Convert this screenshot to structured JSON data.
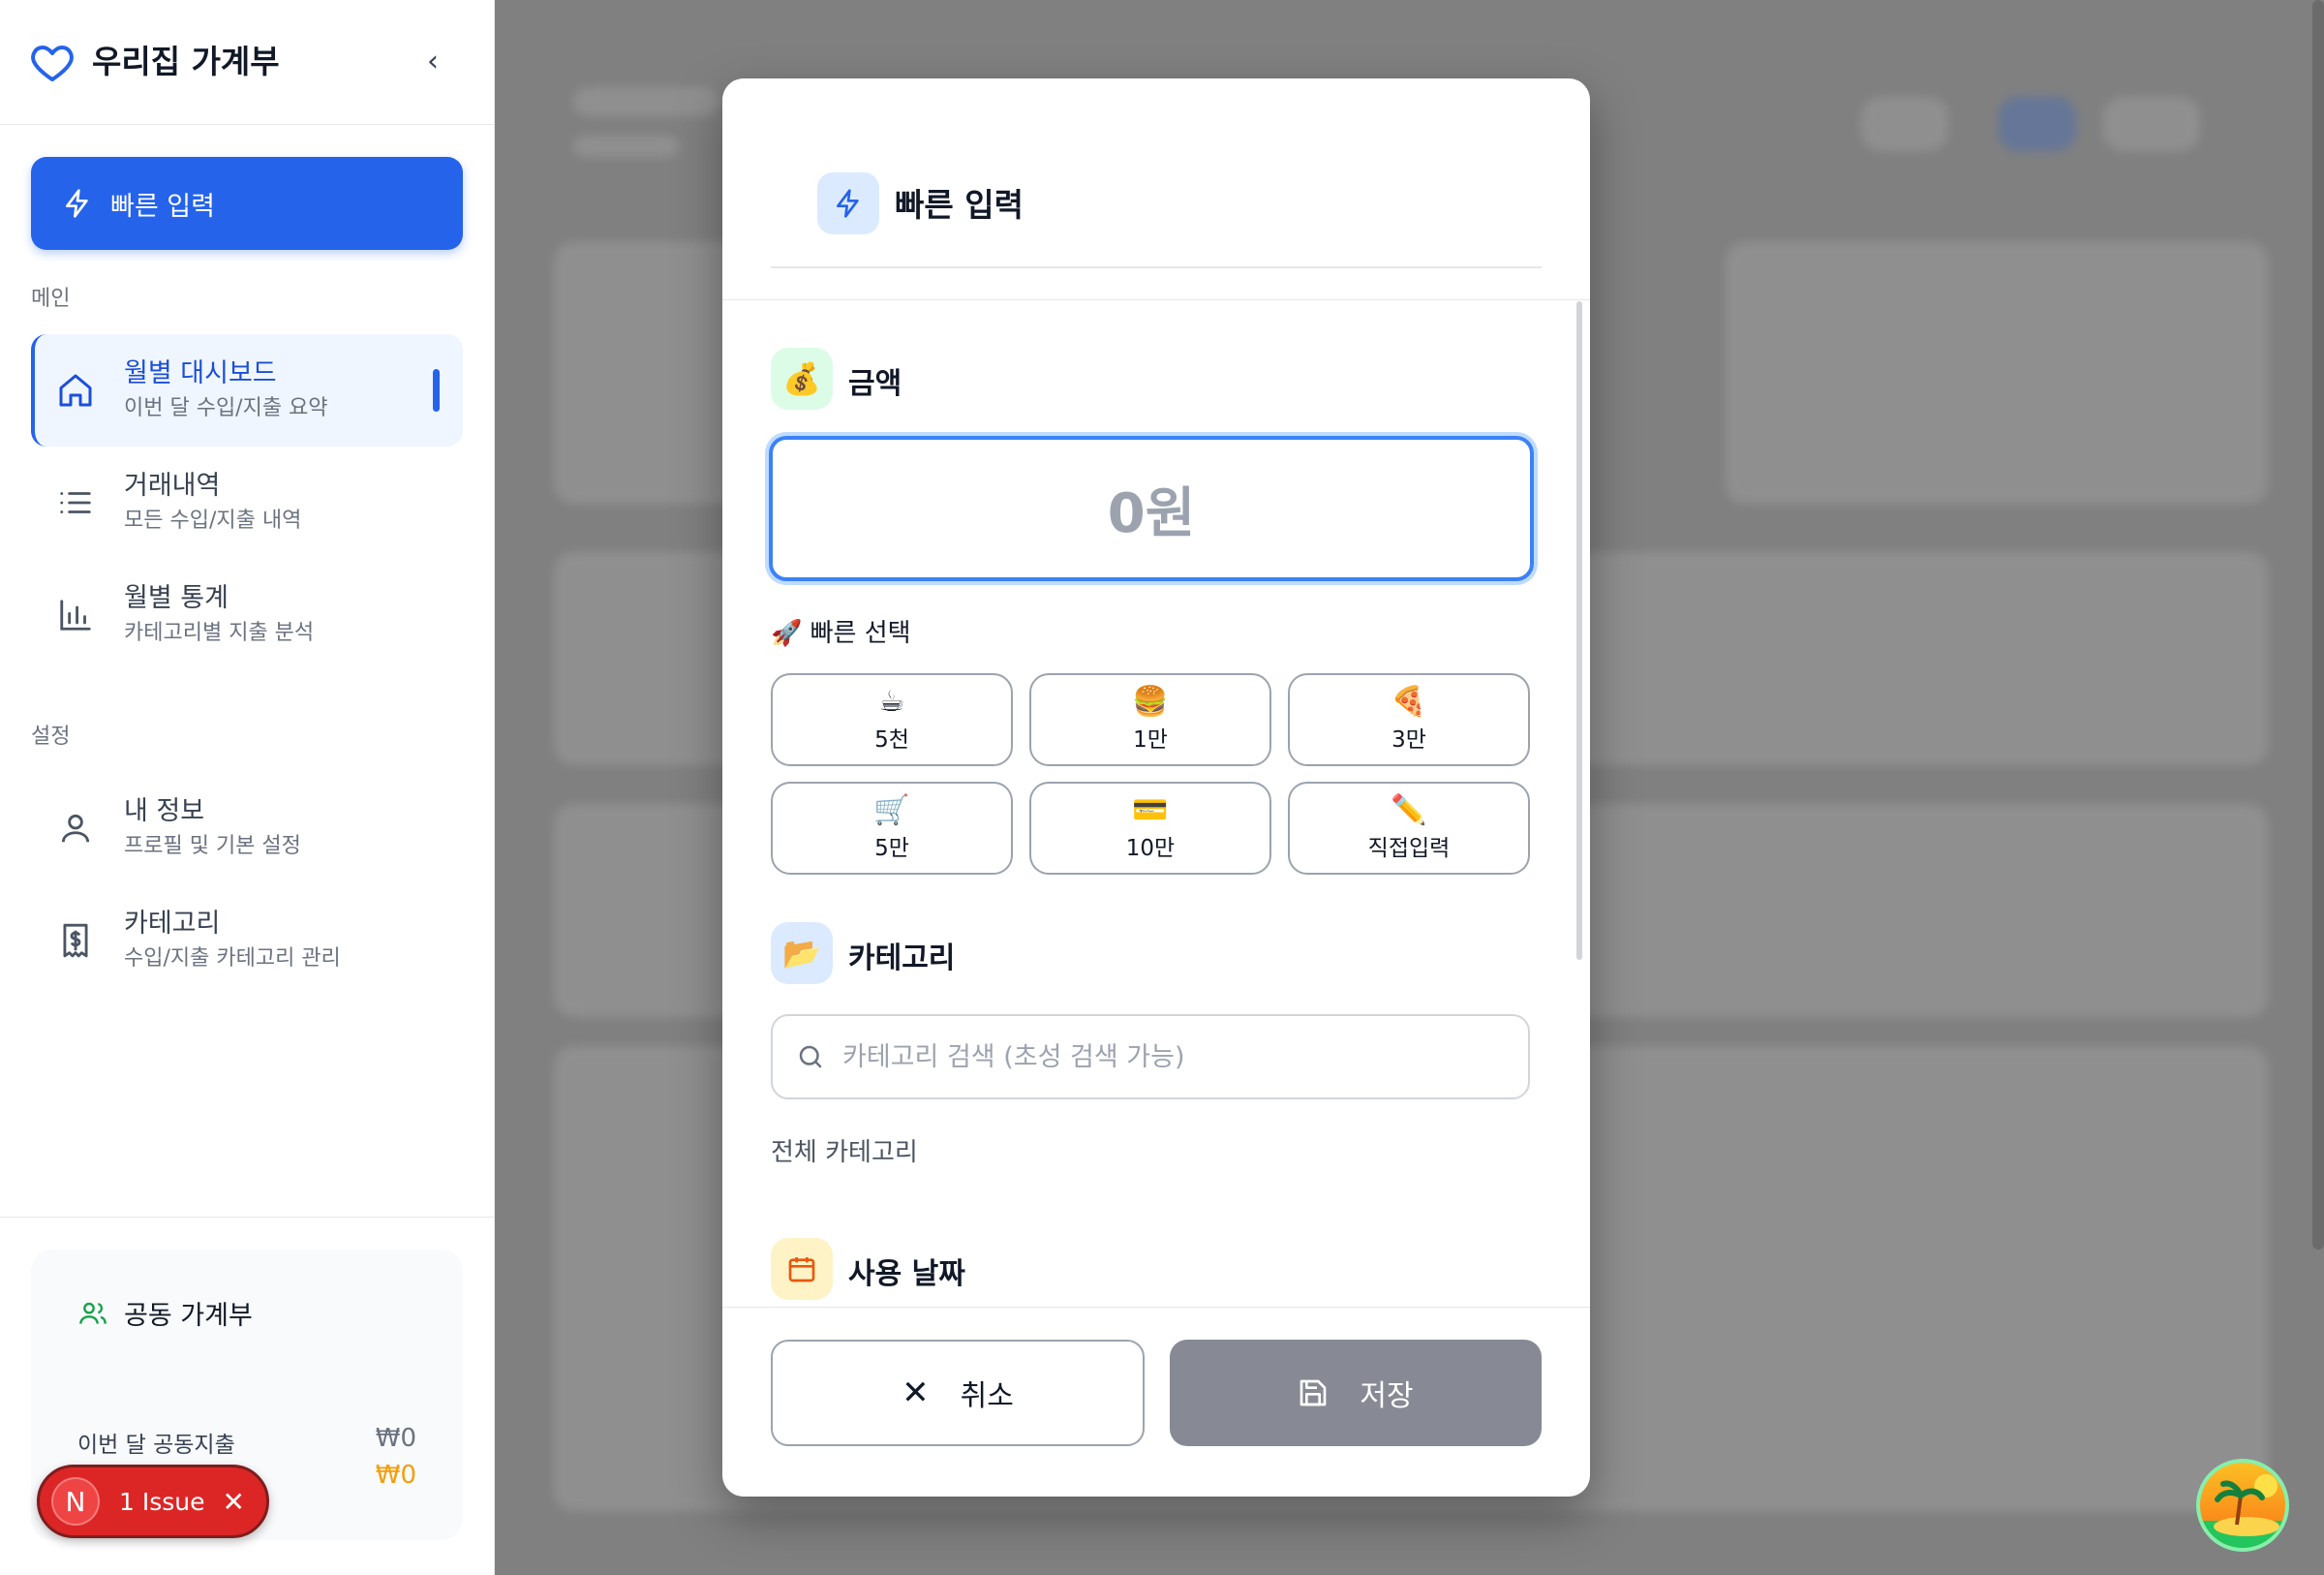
{
  "sidebar": {
    "title": "우리집 가계부",
    "collapse_glyph": "‹",
    "quick_entry_label": "빠른 입력",
    "section_main": "메인",
    "section_settings": "설정",
    "items": [
      {
        "label": "월별 대시보드",
        "desc": "이번 달 수입/지출 요약",
        "icon": "home-icon",
        "active": true
      },
      {
        "label": "거래내역",
        "desc": "모든 수입/지출 내역",
        "icon": "list-icon"
      },
      {
        "label": "월별 통계",
        "desc": "카테고리별 지출 분석",
        "icon": "bar-chart-icon"
      },
      {
        "label": "내 정보",
        "desc": "프로필 및 기본 설정",
        "icon": "user-icon"
      },
      {
        "label": "카테고리",
        "desc": "수입/지출 카테고리 관리",
        "icon": "receipt-icon"
      }
    ],
    "shared": {
      "title": "공동 가계부",
      "month_label": "이번 달 공동지출",
      "value1": "₩0",
      "value2": "₩0"
    }
  },
  "issue_badge": {
    "letter": "N",
    "label": "1 Issue",
    "close": "✕"
  },
  "modal": {
    "title": "빠른 입력",
    "amount_section": "금액",
    "amount_emoji": "💰",
    "amount_value": "0원",
    "quick_select_label": "🚀 빠른 선택",
    "quick_buttons": [
      {
        "emoji": "☕",
        "label": "5천"
      },
      {
        "emoji": "🍔",
        "label": "1만"
      },
      {
        "emoji": "🍕",
        "label": "3만"
      },
      {
        "emoji": "🛒",
        "label": "5만"
      },
      {
        "emoji": "💳",
        "label": "10만"
      },
      {
        "emoji": "✏️",
        "label": "직접입력"
      }
    ],
    "category_section": "카테고리",
    "category_emoji": "📂",
    "category_search_placeholder": "카테고리 검색 (초성 검색 가능)",
    "all_categories_label": "전체 카테고리",
    "date_section": "사용 날짜",
    "cancel_label": "취소",
    "save_label": "저장"
  },
  "colors": {
    "accent": "#2563eb",
    "overlay": "#808080",
    "save_disabled": "#878a94",
    "amount_bg": "#dcfce7",
    "category_bg": "#dbeafe",
    "date_bg": "#fef3c7"
  }
}
